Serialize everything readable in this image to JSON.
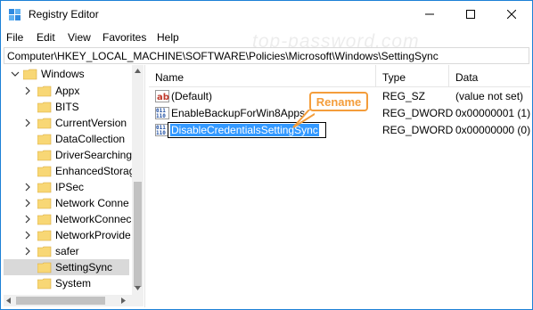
{
  "window": {
    "title": "Registry Editor"
  },
  "menu": [
    "File",
    "Edit",
    "View",
    "Favorites",
    "Help"
  ],
  "address": "Computer\\HKEY_LOCAL_MACHINE\\SOFTWARE\\Policies\\Microsoft\\Windows\\SettingSync",
  "watermark": "top-password.com",
  "tree": {
    "root": "Windows",
    "children": [
      "Appx",
      "BITS",
      "CurrentVersion",
      "DataCollection",
      "DriverSearching",
      "EnhancedStorag",
      "IPSec",
      "Network Conne",
      "NetworkConnec",
      "NetworkProvide",
      "safer",
      "SettingSync",
      "System"
    ],
    "selected": "SettingSync"
  },
  "list": {
    "columns": [
      "Name",
      "Type",
      "Data"
    ],
    "rows": [
      {
        "name": "(Default)",
        "type": "REG_SZ",
        "data": "(value not set)",
        "icon": "string-value-icon"
      },
      {
        "name": "EnableBackupForWin8Apps",
        "type": "REG_DWORD",
        "data": "0x00000001 (1)",
        "icon": "dword-value-icon"
      },
      {
        "name": "",
        "type": "REG_DWORD",
        "data": "0x00000000 (0)",
        "icon": "dword-value-icon"
      }
    ],
    "rename_value": "DisableCredentialsSettingSync"
  },
  "callout": {
    "label": "Rename",
    "color": "#f49d3b"
  },
  "colors": {
    "selection": "#3399ff",
    "folder": "#f8d775",
    "tree_selected": "#d9d9d9"
  }
}
